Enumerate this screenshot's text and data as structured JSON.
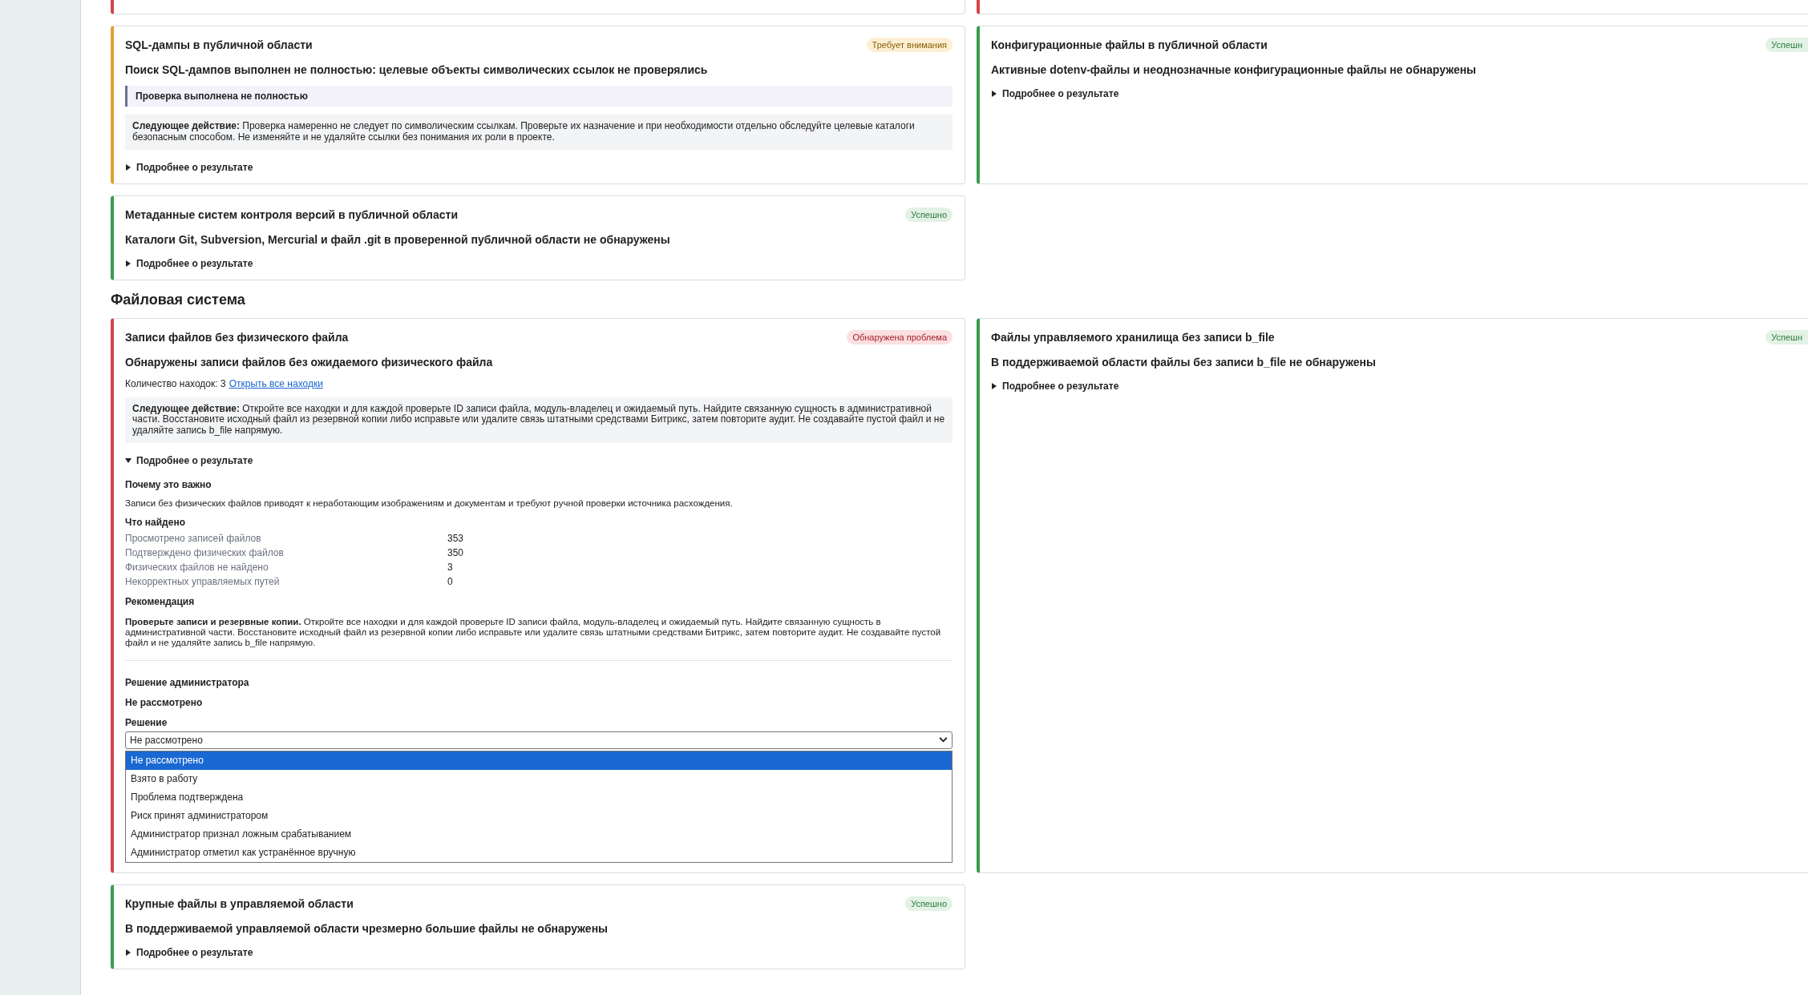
{
  "sections": [
    {
      "left": [
        {
          "kind": "problem"
        }
      ],
      "right": [
        {
          "kind": "problem"
        }
      ]
    },
    {
      "left": [
        {
          "kind": "warning",
          "title": "SQL-дампы в публичной области",
          "badge": "Требует внимания",
          "summary": "Поиск SQL-дампов выполнен не полностью: целевые объекты символических ссылок не проверялись",
          "notice": "Проверка выполнена не полностью",
          "next_action": "**Следующее действие:** Проверка намеренно не следует по символическим ссылкам. Проверьте их назначение и при необходимости отдельно обследуйте целевые каталоги безопасным способом. Не изменяйте и не удаляйте ссылки без понимания их роли в проекте.",
          "details": {
            "label": "Подробнее о результате",
            "expanded": false
          }
        },
        {
          "kind": "success",
          "title": "Метаданные систем контроля версий в публичной области",
          "badge": "Успешно",
          "summary": "Каталоги Git, Subversion, Mercurial и файл .git в проверенной публичной области не обнаружены",
          "details": {
            "label": "Подробнее о результате",
            "expanded": false
          }
        }
      ],
      "right": [
        {
          "kind": "success",
          "title": "Конфигурационные файлы в публичной области",
          "badge": "Успешн",
          "summary": "Активные dotenv-файлы и неоднозначные конфигурационные файлы не обнаружены",
          "details": {
            "label": "Подробнее о результате",
            "expanded": false
          }
        }
      ]
    },
    {
      "title": "Файловая система",
      "left": [
        {
          "kind": "problem",
          "title": "Записи файлов без физического файла",
          "badge": "Обнаружена проблема",
          "summary": "Обнаружены записи файлов без ожидаемого физического файла",
          "count": "Количество находок: 3",
          "link": "Открыть все находки",
          "next_action": "**Следующее действие:** Откройте все находки и для каждой проверьте ID записи файла, модуль-владелец и ожидаемый путь. Найдите связанную сущность в административной части. Восстановите исходный файл из резервной копии либо исправьте или удалите связь штатными средствами Битрикс, затем повторите аудит. Не создавайте пустой файл и не удаляйте запись b_file напрямую.",
          "details": {
            "label": "Подробнее о результате",
            "expanded": true,
            "why_title": "Почему это важно",
            "why_text": "Записи без физических файлов приводят к неработающим изображениям и документам и требуют ручной проверки источника расхождения.",
            "found_title": "Что найдено",
            "found": [
              {
                "label": "Просмотрено записей файлов",
                "value": "353"
              },
              {
                "label": "Подтверждено физических файлов",
                "value": "350"
              },
              {
                "label": "Физических файлов не найдено",
                "value": "3"
              },
              {
                "label": "Некорректных управляемых путей",
                "value": "0"
              }
            ],
            "recommendation_title": "Рекомендация",
            "recommendation": "**Проверьте записи и резервные копии.** Откройте все находки и для каждой проверьте ID записи файла, модуль-владелец и ожидаемый путь. Найдите связанную сущность в административной части. Восстановите исходный файл из резервной копии либо исправьте или удалите связь штатными средствами Битрикс, затем повторите аудит. Не создавайте пустой файл и не удаляйте запись b_file напрямую.",
            "decision_title": "Решение администратора",
            "decision_status": "Не рассмотрено",
            "select_label": "Решение",
            "select_value": "Не рассмотрено",
            "options": [
              {
                "label": "Не рассмотрено",
                "selected": true
              },
              {
                "label": "Взято в работу",
                "selected": false
              },
              {
                "label": "Проблема подтверждена",
                "selected": false
              },
              {
                "label": "Риск принят администратором",
                "selected": false
              },
              {
                "label": "Администратор признал ложным срабатыванием",
                "selected": false
              },
              {
                "label": "Администратор отметил как устранённое вручную",
                "selected": false
              }
            ]
          }
        },
        {
          "kind": "success",
          "title": "Крупные файлы в управляемой области",
          "badge": "Успешно",
          "summary": "В поддерживаемой управляемой области чрезмерно большие файлы не обнаружены",
          "details": {
            "label": "Подробнее о результате",
            "expanded": false
          }
        }
      ],
      "right": [
        {
          "kind": "success",
          "title": "Файлы управляемого хранилища без записи b_file",
          "badge": "Успешн",
          "summary": "В поддерживаемой области файлы без записи b_file не обнаружены",
          "details": {
            "label": "Подробнее о результате",
            "expanded": false
          }
        }
      ]
    }
  ]
}
